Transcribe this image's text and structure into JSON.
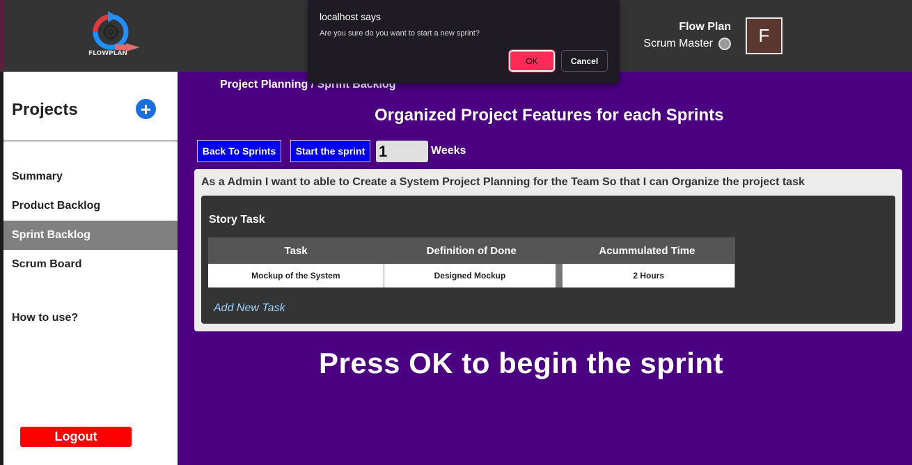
{
  "header": {
    "logo_text": "FLOWPLAN",
    "user_name": "Flow Plan",
    "user_role": "Scrum Master",
    "avatar_initial": "F"
  },
  "sidebar": {
    "title": "Projects",
    "add_icon": "plus-circle-icon",
    "items": [
      {
        "label": "Summary",
        "active": false
      },
      {
        "label": "Product Backlog",
        "active": false
      },
      {
        "label": "Sprint Backlog",
        "active": true
      },
      {
        "label": "Scrum Board",
        "active": false
      }
    ],
    "help_label": "How to use?",
    "logout_label": "Logout"
  },
  "main": {
    "breadcrumb": "Project Planning / Sprint Backlog",
    "title": "Organized Project Features for each Sprints",
    "back_button": "Back To Sprints",
    "start_button": "Start the sprint",
    "weeks_value": "1",
    "weeks_label": "Weeks",
    "story": {
      "text": "As a Admin I want to able to Create a System Project Planning for the Team So that I can Organize the project task",
      "panel_title": "Story Task",
      "columns": [
        "Task",
        "Definition of Done",
        "Acummulated Time"
      ],
      "rows": [
        [
          "Mockup of the System",
          "Designed Mockup",
          "2 Hours"
        ]
      ],
      "add_task_label": "Add New Task"
    }
  },
  "overlay_caption": "Press OK to begin the sprint",
  "dialog": {
    "title": "localhost says",
    "message": "Are you sure do you want to start a new sprint?",
    "ok_label": "OK",
    "cancel_label": "Cancel"
  },
  "colors": {
    "main_bg": "#4b0082",
    "topbar_bg": "#343434",
    "primary_button": "#0000ee",
    "logout_button": "#ff0000",
    "dialog_ok": "#ff2a55"
  }
}
